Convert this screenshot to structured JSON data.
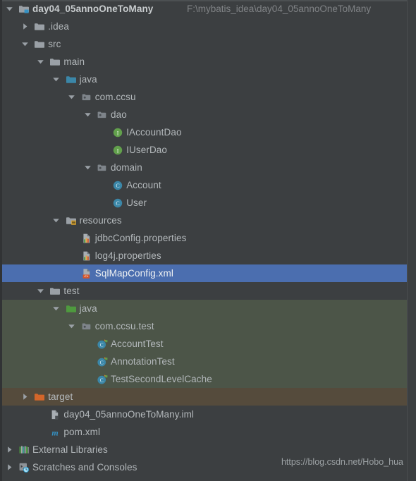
{
  "window": {
    "title": "Project",
    "background_color": "#3c3f41",
    "selection_color": "#4b6eaf",
    "text_color": "#b3b8bb",
    "test_root_band_color": "#4c5548",
    "excluded_root_band_color": "#554b3c"
  },
  "root": {
    "label": "day04_05annoOneToMany",
    "path": "F:\\mybatis_idea\\day04_05annoOneToMany"
  },
  "watermark": "https://blog.csdn.net/Hobo_hua",
  "tree": [
    {
      "label": "day04_05annoOneToMany",
      "icon": "project-folder-icon",
      "depth": 0,
      "twisty": "expanded",
      "bold": true,
      "selected": false,
      "band": "none"
    },
    {
      "label": ".idea",
      "icon": "folder-icon",
      "depth": 1,
      "twisty": "collapsed",
      "bold": false,
      "selected": false,
      "band": "none"
    },
    {
      "label": "src",
      "icon": "folder-icon",
      "depth": 1,
      "twisty": "expanded",
      "bold": false,
      "selected": false,
      "band": "none"
    },
    {
      "label": "main",
      "icon": "folder-icon",
      "depth": 2,
      "twisty": "expanded",
      "bold": false,
      "selected": false,
      "band": "none"
    },
    {
      "label": "java",
      "icon": "source-folder-icon",
      "depth": 3,
      "twisty": "expanded",
      "bold": false,
      "selected": false,
      "band": "none"
    },
    {
      "label": "com.ccsu",
      "icon": "package-icon",
      "depth": 4,
      "twisty": "expanded",
      "bold": false,
      "selected": false,
      "band": "none"
    },
    {
      "label": "dao",
      "icon": "package-icon",
      "depth": 5,
      "twisty": "expanded",
      "bold": false,
      "selected": false,
      "band": "none"
    },
    {
      "label": "IAccountDao",
      "icon": "interface-icon",
      "depth": 6,
      "twisty": "none",
      "bold": false,
      "selected": false,
      "band": "none"
    },
    {
      "label": "IUserDao",
      "icon": "interface-icon",
      "depth": 6,
      "twisty": "none",
      "bold": false,
      "selected": false,
      "band": "none"
    },
    {
      "label": "domain",
      "icon": "package-icon",
      "depth": 5,
      "twisty": "expanded",
      "bold": false,
      "selected": false,
      "band": "none"
    },
    {
      "label": "Account",
      "icon": "class-icon",
      "depth": 6,
      "twisty": "none",
      "bold": false,
      "selected": false,
      "band": "none"
    },
    {
      "label": "User",
      "icon": "class-icon",
      "depth": 6,
      "twisty": "none",
      "bold": false,
      "selected": false,
      "band": "none"
    },
    {
      "label": "resources",
      "icon": "resources-folder-icon",
      "depth": 3,
      "twisty": "expanded",
      "bold": false,
      "selected": false,
      "band": "none"
    },
    {
      "label": "jdbcConfig.properties",
      "icon": "properties-file-icon",
      "depth": 4,
      "twisty": "none",
      "bold": false,
      "selected": false,
      "band": "none"
    },
    {
      "label": "log4j.properties",
      "icon": "properties-file-icon",
      "depth": 4,
      "twisty": "none",
      "bold": false,
      "selected": false,
      "band": "none"
    },
    {
      "label": "SqlMapConfig.xml",
      "icon": "xml-file-icon",
      "depth": 4,
      "twisty": "none",
      "bold": false,
      "selected": true,
      "band": "none"
    },
    {
      "label": "test",
      "icon": "folder-icon",
      "depth": 2,
      "twisty": "expanded",
      "bold": false,
      "selected": false,
      "band": "none"
    },
    {
      "label": "java",
      "icon": "test-source-folder-icon",
      "depth": 3,
      "twisty": "expanded",
      "bold": false,
      "selected": false,
      "band": "test"
    },
    {
      "label": "com.ccsu.test",
      "icon": "package-icon",
      "depth": 4,
      "twisty": "expanded",
      "bold": false,
      "selected": false,
      "band": "test"
    },
    {
      "label": "AccountTest",
      "icon": "test-class-icon",
      "depth": 5,
      "twisty": "none",
      "bold": false,
      "selected": false,
      "band": "test"
    },
    {
      "label": "AnnotationTest",
      "icon": "test-class-icon",
      "depth": 5,
      "twisty": "none",
      "bold": false,
      "selected": false,
      "band": "test"
    },
    {
      "label": "TestSecondLevelCache",
      "icon": "test-class-icon",
      "depth": 5,
      "twisty": "none",
      "bold": false,
      "selected": false,
      "band": "test"
    },
    {
      "label": "target",
      "icon": "excluded-folder-icon",
      "depth": 1,
      "twisty": "collapsed",
      "bold": false,
      "selected": false,
      "band": "target"
    },
    {
      "label": "day04_05annoOneToMany.iml",
      "icon": "iml-file-icon",
      "depth": 2,
      "twisty": "none",
      "bold": false,
      "selected": false,
      "band": "none"
    },
    {
      "label": "pom.xml",
      "icon": "maven-file-icon",
      "depth": 2,
      "twisty": "none",
      "bold": false,
      "selected": false,
      "band": "none"
    },
    {
      "label": "External Libraries",
      "icon": "libraries-icon",
      "depth": 0,
      "twisty": "collapsed",
      "bold": false,
      "selected": false,
      "band": "none"
    },
    {
      "label": "Scratches and Consoles",
      "icon": "scratches-icon",
      "depth": 0,
      "twisty": "collapsed",
      "bold": false,
      "selected": false,
      "band": "none"
    }
  ]
}
